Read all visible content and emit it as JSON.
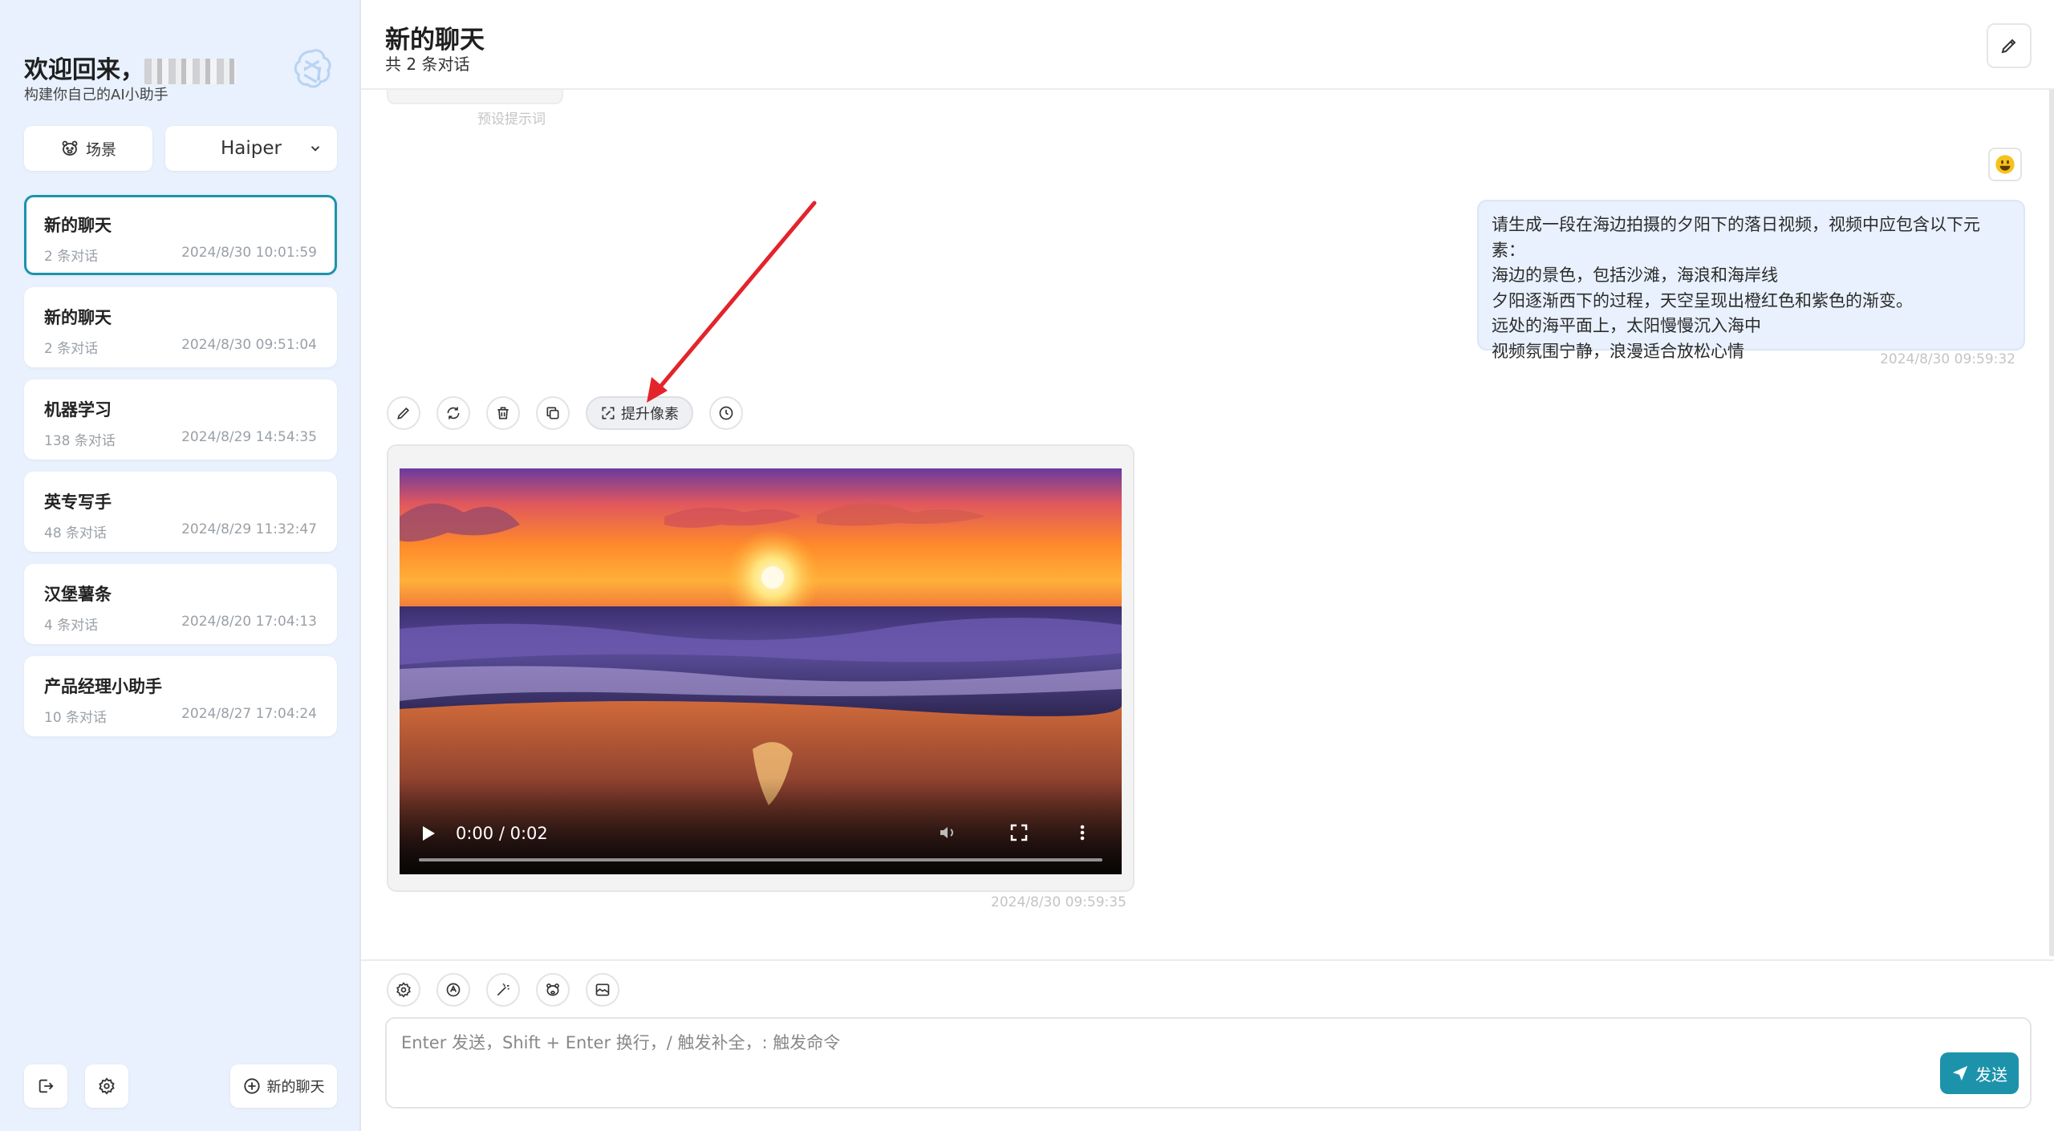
{
  "sidebar": {
    "welcome": "欢迎回来，",
    "subtitle": "构建你自己的AI小助手",
    "scene_label": "场景",
    "model_value": "Haiper",
    "new_chat_label": "新的聊天",
    "chats": [
      {
        "title": "新的聊天",
        "count": "2 条对话",
        "time": "2024/8/30 10:01:59",
        "active": true
      },
      {
        "title": "新的聊天",
        "count": "2 条对话",
        "time": "2024/8/30 09:51:04"
      },
      {
        "title": "机器学习",
        "count": "138 条对话",
        "time": "2024/8/29 14:54:35"
      },
      {
        "title": "英专写手",
        "count": "48 条对话",
        "time": "2024/8/29 11:32:47"
      },
      {
        "title": "汉堡薯条",
        "count": "4 条对话",
        "time": "2024/8/20 17:04:13"
      },
      {
        "title": "产品经理小助手",
        "count": "10 条对话",
        "time": "2024/8/27 17:04:24"
      }
    ]
  },
  "header": {
    "title": "新的聊天",
    "subtitle": "共 2 条对话"
  },
  "messages": {
    "preset_label": "预设提示词",
    "user_lines": [
      "请生成一段在海边拍摄的夕阳下的落日视频，视频中应包含以下元素：",
      "海边的景色，包括沙滩，海浪和海岸线",
      "夕阳逐渐西下的过程，天空呈现出橙红色和紫色的渐变。",
      "远处的海平面上，太阳慢慢沉入海中",
      "视频氛围宁静，浪漫适合放松心情"
    ],
    "user_time": "2024/8/30 09:59:32",
    "upscale_label": "提升像素",
    "video_time_display": "0:00 / 0:02",
    "video_progress": 0,
    "bot_time": "2024/8/30 09:59:35"
  },
  "input": {
    "placeholder": "Enter 发送，Shift + Enter 换行，/ 触发补全，: 触发命令",
    "send_label": "发送"
  },
  "colors": {
    "accent": "#1d93ab",
    "sidebar_bg": "#e8f1fd",
    "annotation_arrow": "#e3242b"
  }
}
